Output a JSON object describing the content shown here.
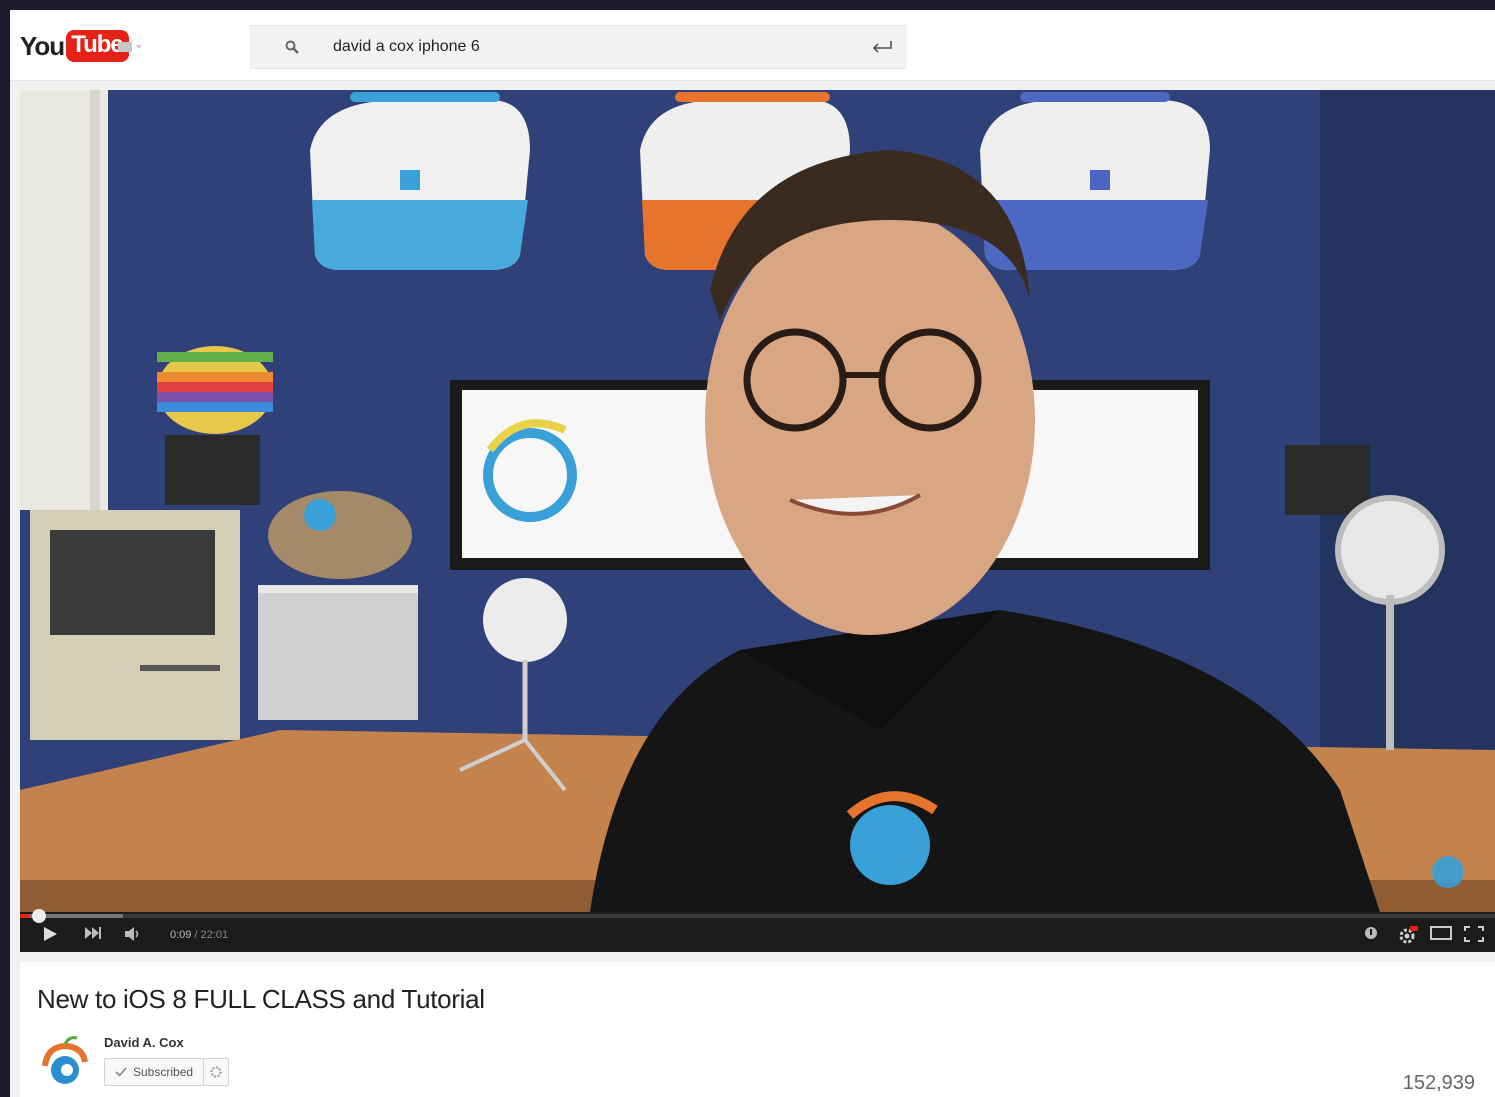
{
  "masthead": {
    "logo": {
      "you": "You",
      "tube": "Tube"
    },
    "guide_icon": "menu-icon",
    "search": {
      "value": "david a cox iphone 6",
      "search_icon": "search-icon",
      "submit_icon": "enter-icon"
    }
  },
  "player": {
    "time_current": "0:09",
    "time_separator": " / ",
    "time_duration": "22:01",
    "progress_played_fraction": 0.007,
    "progress_buffered_fraction": 0.07,
    "controls": [
      "play-icon",
      "next-icon",
      "volume-icon",
      "annotations-icon",
      "settings-icon",
      "theater-mode-icon",
      "fullscreen-icon"
    ]
  },
  "watch": {
    "title": "New to iOS 8 FULL CLASS and Tutorial",
    "channel_name": "David A. Cox",
    "subscribe_label": "Subscribed",
    "view_count": "152,939"
  },
  "colors": {
    "brand_red": "#e62117",
    "link_blue": "#167ac6"
  }
}
